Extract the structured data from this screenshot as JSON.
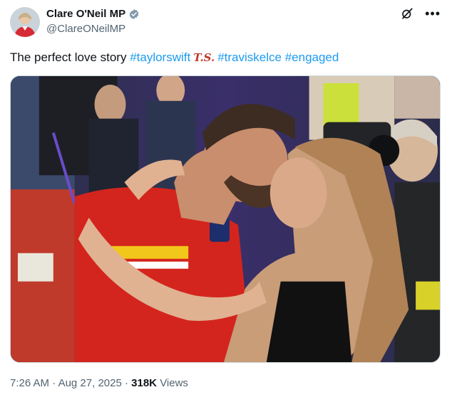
{
  "author": {
    "display_name": "Clare O'Neil MP",
    "handle": "@ClareONeilMP",
    "verified": true
  },
  "tweet": {
    "text_plain": "The perfect love story ",
    "hashtags": [
      "#taylorswift",
      "#traviskelce",
      "#engaged"
    ],
    "ts_emoji": "T.S."
  },
  "meta": {
    "time": "7:26 AM",
    "separator": "·",
    "date": "Aug 27, 2025",
    "views_count": "318K",
    "views_label": "Views"
  },
  "icons": {
    "verified": "verified-badge-icon",
    "grok": "grok-icon",
    "more": "more-icon"
  },
  "colors": {
    "hashtag": "#1d9bf0",
    "text": "#0f1419",
    "secondary": "#536471",
    "verified": "#829aab"
  }
}
